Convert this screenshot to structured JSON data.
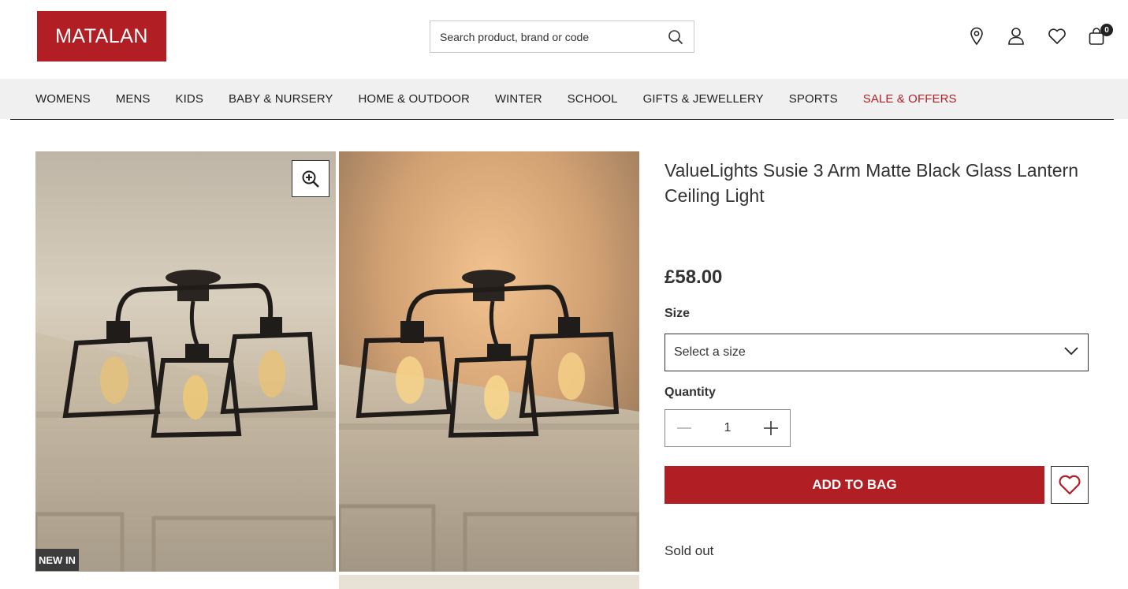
{
  "brand": {
    "logo_text": "MATALAN",
    "color": "#b11f24"
  },
  "search": {
    "placeholder": "Search product, brand or code",
    "icon": "search-icon"
  },
  "header_icons": [
    {
      "name": "store-locator-icon"
    },
    {
      "name": "account-icon"
    },
    {
      "name": "wishlist-icon"
    },
    {
      "name": "bag-icon",
      "badge": "0"
    }
  ],
  "nav": {
    "items": [
      "WOMENS",
      "MENS",
      "KIDS",
      "BABY & NURSERY",
      "HOME & OUTDOOR",
      "WINTER",
      "SCHOOL",
      "GIFTS & JEWELLERY",
      "SPORTS",
      "SALE & OFFERS"
    ]
  },
  "gallery": {
    "badge": "NEW IN",
    "zoom_icon": "zoom-in-icon"
  },
  "product": {
    "title": "ValueLights Susie 3 Arm Matte Black Glass Lantern Ceiling Light",
    "price": "£58.00",
    "size_label": "Size",
    "size_placeholder": "Select a size",
    "quantity_label": "Quantity",
    "quantity": "1",
    "add_to_bag": "ADD TO BAG",
    "stock_status": "Sold out"
  }
}
